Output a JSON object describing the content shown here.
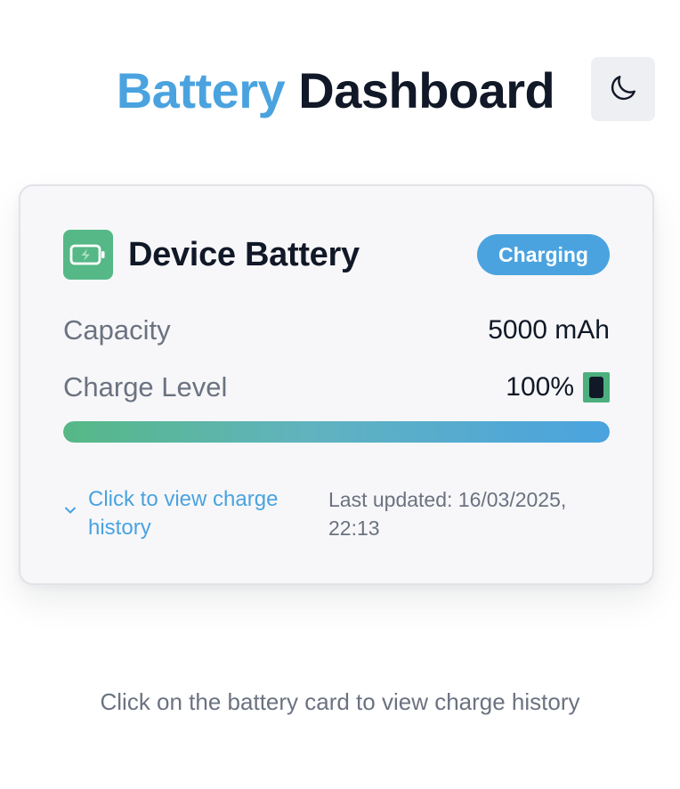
{
  "header": {
    "title_accent": "Battery",
    "title_rest": "Dashboard",
    "theme_toggle_icon": "moon-icon"
  },
  "card": {
    "device_icon": "battery-charging-icon",
    "device_name": "Device Battery",
    "status": "Charging",
    "capacity_label": "Capacity",
    "capacity_value": "5000 mAh",
    "charge_label": "Charge Level",
    "charge_value": "100%",
    "charge_percent": 100,
    "battery_emoji_icon": "battery-icon",
    "history_link": "Click to view charge history",
    "last_updated": "Last updated: 16/03/2025, 22:13"
  },
  "hint": "Click on the battery card to view charge history",
  "colors": {
    "accent": "#4aa3df",
    "success": "#55b886",
    "text": "#111827",
    "muted": "#6b7280"
  }
}
